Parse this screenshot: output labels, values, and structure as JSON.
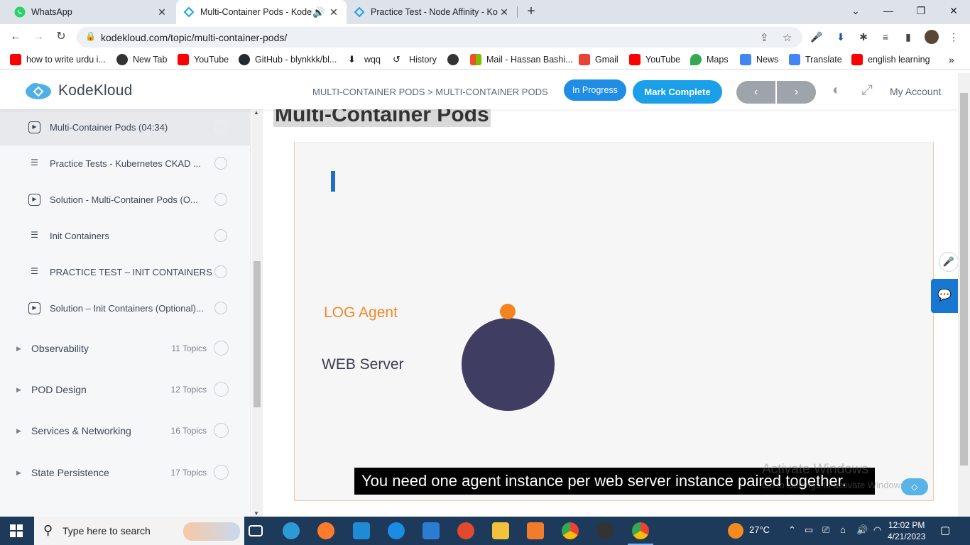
{
  "browser": {
    "tabs": [
      {
        "title": "WhatsApp",
        "icon": "whatsapp-icon",
        "color": "#25d366"
      },
      {
        "title": "Multi-Container Pods - Kodek",
        "icon": "kodekloud-icon",
        "color": "#1aa0e8"
      },
      {
        "title": "Practice Test - Node Affinity - Ko",
        "icon": "kodekloud-icon",
        "color": "#1aa0e8"
      }
    ],
    "url": "kodekloud.com/topic/multi-container-pods/",
    "bookmarks": [
      {
        "label": "how to write urdu i...",
        "icon": "youtube-icon",
        "color": "#ff0000"
      },
      {
        "label": "New Tab",
        "icon": "newtab-icon",
        "color": "#333333"
      },
      {
        "label": "YouTube",
        "icon": "youtube-icon",
        "color": "#ff0000"
      },
      {
        "label": "GitHub - blynkkk/bl...",
        "icon": "github-icon",
        "color": "#24292e"
      },
      {
        "label": "wqq",
        "icon": "download-icon",
        "color": "#333333"
      },
      {
        "label": "History",
        "icon": "history-icon",
        "color": "#333333"
      },
      {
        "label": "",
        "icon": "globe-icon",
        "color": "#333333"
      },
      {
        "label": "Mail - Hassan Bashi...",
        "icon": "microsoft-icon",
        "color": "#f25022"
      },
      {
        "label": "Gmail",
        "icon": "gmail-icon",
        "color": "#ea4335"
      },
      {
        "label": "YouTube",
        "icon": "youtube-icon",
        "color": "#ff0000"
      },
      {
        "label": "Maps",
        "icon": "maps-icon",
        "color": "#34a853"
      },
      {
        "label": "News",
        "icon": "news-icon",
        "color": "#4285f4"
      },
      {
        "label": "Translate",
        "icon": "translate-icon",
        "color": "#4285f4"
      },
      {
        "label": "english learning",
        "icon": "youtube-icon",
        "color": "#ff0000"
      }
    ]
  },
  "header": {
    "logo": "KodeKloud",
    "breadcrumb": "MULTI-CONTAINER PODS > MULTI-CONTAINER PODS",
    "status": "In Progress",
    "mark_complete": "Mark Complete",
    "prev": "‹",
    "next": "›",
    "account": "My Account"
  },
  "sidebar": {
    "lessons": [
      {
        "label": "Multi-Container Pods (04:34)",
        "type": "video",
        "current": true
      },
      {
        "label": "Practice Tests - Kubernetes CKAD ...",
        "type": "lab",
        "current": false
      },
      {
        "label": "Solution - Multi-Container Pods (O...",
        "type": "video",
        "current": false
      },
      {
        "label": "Init Containers",
        "type": "lab",
        "current": false
      },
      {
        "label": "PRACTICE TEST – INIT CONTAINERS",
        "type": "lab",
        "current": false
      },
      {
        "label": "Solution – Init Containers (Optional)...",
        "type": "video",
        "current": false
      }
    ],
    "sections": [
      {
        "label": "Observability",
        "count": "11 Topics"
      },
      {
        "label": "POD Design",
        "count": "12 Topics"
      },
      {
        "label": "Services & Networking",
        "count": "16 Topics"
      },
      {
        "label": "State Persistence",
        "count": "17 Topics"
      }
    ]
  },
  "main": {
    "title": "Multi-Container Pods",
    "video": {
      "log_agent": "LOG Agent",
      "web_server": "WEB Server",
      "subtitle": "You need one agent instance per web server instance paired together.",
      "watermark_line1": "Activate Windows",
      "watermark_line2": "Go to Settings to activate Windows."
    }
  },
  "taskbar": {
    "search_placeholder": "Type here to search",
    "weather": "27°C",
    "time": "12:02 PM",
    "date": "4/21/2023"
  }
}
